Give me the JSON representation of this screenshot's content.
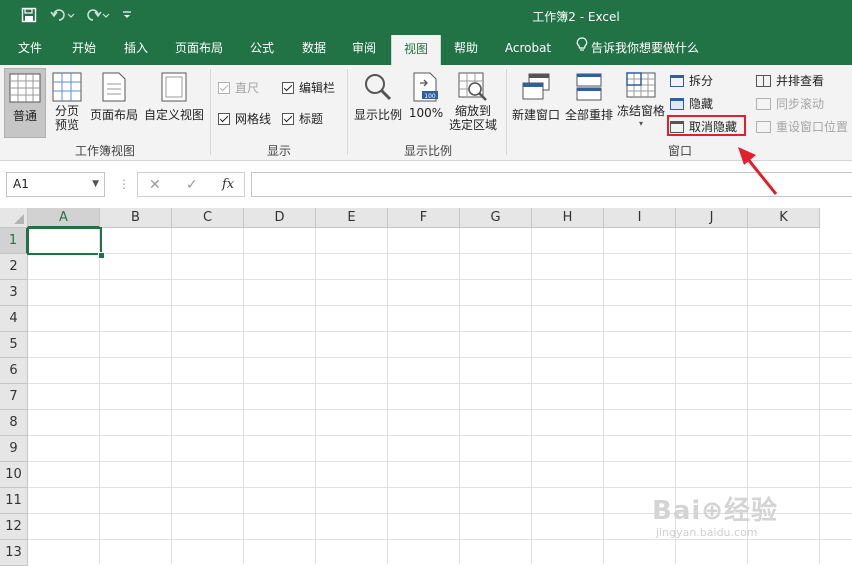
{
  "titlebar": {
    "title": "工作簿2  -  Excel",
    "save_icon": "save-icon",
    "undo_icon": "undo-icon",
    "redo_icon": "redo-icon",
    "customize_icon": "customize-qat-icon"
  },
  "tabs": [
    {
      "label": "文件"
    },
    {
      "label": "开始"
    },
    {
      "label": "插入"
    },
    {
      "label": "页面布局"
    },
    {
      "label": "公式"
    },
    {
      "label": "数据"
    },
    {
      "label": "审阅"
    },
    {
      "label": "视图"
    },
    {
      "label": "帮助"
    },
    {
      "label": "Acrobat"
    }
  ],
  "tellme": {
    "label": "告诉我你想要做什么",
    "icon": "lightbulb-icon"
  },
  "ribbon": {
    "workbook_views": {
      "label": "工作簿视图",
      "normal": "普通",
      "page_break_line1": "分页",
      "page_break_line2": "预览",
      "page_layout": "页面布局",
      "custom_views": "自定义视图"
    },
    "show": {
      "label": "显示",
      "ruler": "直尺",
      "gridlines": "网格线",
      "formula_bar": "编辑栏",
      "headings": "标题"
    },
    "zoom": {
      "label": "显示比例",
      "zoom": "显示比例",
      "hundred": "100%",
      "zoom_sel_line1": "缩放到",
      "zoom_sel_line2": "选定区域",
      "badge": "100"
    },
    "window": {
      "label": "窗口",
      "new_window": "新建窗口",
      "arrange_all": "全部重排",
      "freeze": "冻结窗格",
      "split": "拆分",
      "hide": "隐藏",
      "unhide": "取消隐藏",
      "side_by_side": "并排查看",
      "sync_scroll": "同步滚动",
      "reset_position": "重设窗口位置"
    }
  },
  "formula_bar": {
    "name_box": "A1",
    "cancel": "✕",
    "enter": "✓",
    "fx": "fx",
    "value": ""
  },
  "grid": {
    "columns": [
      "A",
      "B",
      "C",
      "D",
      "E",
      "F",
      "G",
      "H",
      "I",
      "J",
      "K"
    ],
    "rows": [
      "1",
      "2",
      "3",
      "4",
      "5",
      "6",
      "7",
      "8",
      "9",
      "10",
      "11",
      "12",
      "13"
    ],
    "active_cell": "A1"
  },
  "watermark": {
    "main": "Bai⊕经验",
    "sub": "jingyan.baidu.com"
  },
  "colors": {
    "accent": "#217346",
    "highlight": "#e0202d"
  }
}
